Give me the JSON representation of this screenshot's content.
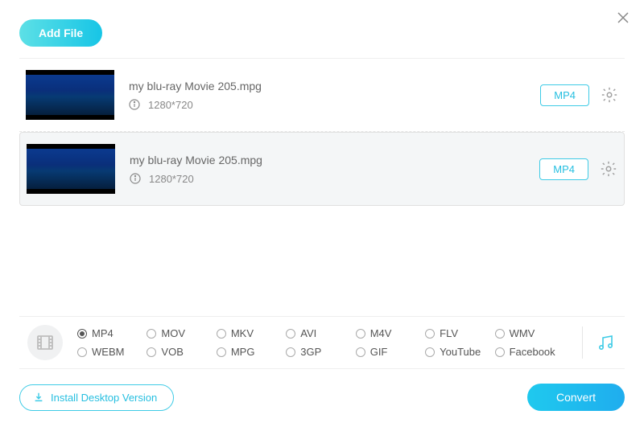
{
  "topbar": {
    "addFile": "Add File"
  },
  "close": "×",
  "files": [
    {
      "name": "my blu-ray Movie 205.mpg",
      "resolution": "1280*720",
      "format": "MP4",
      "selected": false
    },
    {
      "name": "my blu-ray Movie 205.mpg",
      "resolution": "1280*720",
      "format": "MP4",
      "selected": true
    }
  ],
  "formats": {
    "row1": [
      "MP4",
      "MOV",
      "MKV",
      "AVI",
      "M4V",
      "FLV",
      "WMV"
    ],
    "row2": [
      "WEBM",
      "VOB",
      "MPG",
      "3GP",
      "GIF",
      "YouTube",
      "Facebook"
    ],
    "selected": "MP4"
  },
  "footer": {
    "install": "Install Desktop Version",
    "convert": "Convert"
  }
}
